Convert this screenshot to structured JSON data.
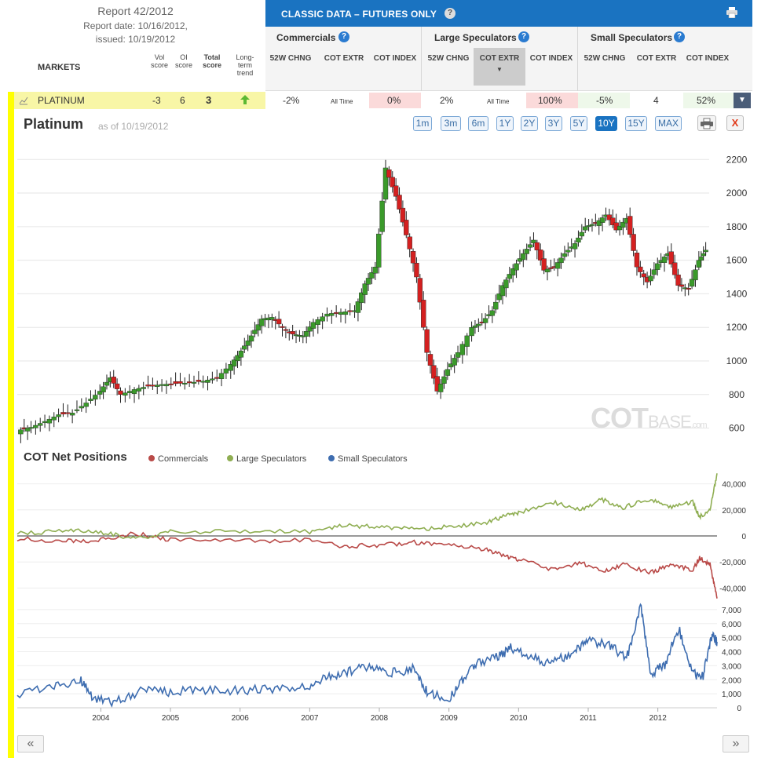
{
  "report": {
    "title": "Report 42/2012",
    "report_date": "Report date: 10/16/2012,",
    "issued": "issued: 10/19/2012"
  },
  "markets_header": {
    "markets": "MARKETS",
    "vol_score": "Vol score",
    "oi_score": "OI score",
    "total_score": "Total score",
    "long_term_trend": "Long-term trend"
  },
  "classic": {
    "title": "CLASSIC DATA – FUTURES ONLY",
    "help": "?"
  },
  "groups": [
    {
      "name": "Commercials",
      "cols": [
        "52W CHNG",
        "COT EXTR",
        "COT INDEX"
      ]
    },
    {
      "name": "Large Speculators",
      "cols": [
        "52W CHNG",
        "COT EXTR",
        "COT INDEX"
      ]
    },
    {
      "name": "Small Speculators",
      "cols": [
        "52W CHNG",
        "COT EXTR",
        "COT INDEX"
      ]
    }
  ],
  "platinum_row": {
    "name": "PLATINUM",
    "vol": "-3",
    "oi": "6",
    "total": "3",
    "comm_chng": "-2%",
    "comm_extr": "All Time",
    "comm_index": "0%",
    "large_chng": "2%",
    "large_extr": "All Time",
    "large_index": "100%",
    "small_chng": "-5%",
    "small_extr": "4",
    "small_index": "52%"
  },
  "chart_header": {
    "title": "Platinum",
    "as_of": "as of 10/19/2012",
    "ranges": [
      "1m",
      "3m",
      "6m",
      "1Y",
      "2Y",
      "3Y",
      "5Y",
      "10Y",
      "15Y",
      "MAX"
    ],
    "active_range": "10Y",
    "close_label": "X"
  },
  "cot_header": {
    "title": "COT Net Positions",
    "legend": [
      {
        "name": "Commercials",
        "color": "#b94a48"
      },
      {
        "name": "Large Speculators",
        "color": "#8fae52"
      },
      {
        "name": "Small Speculators",
        "color": "#3e6db0"
      }
    ]
  },
  "watermark": {
    "main": "COT",
    "sub": "BASE",
    "suffix": ".com"
  },
  "nav": {
    "prev": "«",
    "next": "»"
  },
  "colors": {
    "header_blue": "#1a73c1",
    "candle_up": "#3a9a2a",
    "candle_down": "#d42020",
    "highlight_yellow": "#ffff00",
    "row_yellow": "#f8f6a6",
    "trend_up": "#5cb832"
  },
  "chart_data": [
    {
      "type": "candlestick",
      "title": "Platinum",
      "x_axis": "date",
      "y_ticks": [
        600,
        800,
        1000,
        1200,
        1400,
        1600,
        1800,
        2000,
        2200
      ],
      "x_ticks": [
        "2004",
        "2005",
        "2006",
        "2007",
        "2008",
        "2009",
        "2010",
        "2011",
        "2012"
      ],
      "x_range": [
        2002.8,
        2012.85
      ],
      "y_range": [
        570,
        2290
      ],
      "closes": [
        [
          2002.85,
          590
        ],
        [
          2003.0,
          605
        ],
        [
          2003.2,
          640
        ],
        [
          2003.4,
          680
        ],
        [
          2003.6,
          690
        ],
        [
          2003.8,
          750
        ],
        [
          2004.0,
          820
        ],
        [
          2004.15,
          900
        ],
        [
          2004.3,
          800
        ],
        [
          2004.5,
          830
        ],
        [
          2004.7,
          850
        ],
        [
          2004.9,
          860
        ],
        [
          2005.1,
          865
        ],
        [
          2005.3,
          870
        ],
        [
          2005.5,
          880
        ],
        [
          2005.7,
          900
        ],
        [
          2005.9,
          980
        ],
        [
          2006.05,
          1060
        ],
        [
          2006.2,
          1150
        ],
        [
          2006.35,
          1250
        ],
        [
          2006.5,
          1260
        ],
        [
          2006.65,
          1200
        ],
        [
          2006.8,
          1160
        ],
        [
          2006.95,
          1150
        ],
        [
          2007.1,
          1230
        ],
        [
          2007.3,
          1280
        ],
        [
          2007.5,
          1290
        ],
        [
          2007.7,
          1300
        ],
        [
          2007.85,
          1460
        ],
        [
          2008.0,
          1560
        ],
        [
          2008.15,
          2150
        ],
        [
          2008.3,
          1980
        ],
        [
          2008.45,
          1750
        ],
        [
          2008.6,
          1500
        ],
        [
          2008.75,
          1050
        ],
        [
          2008.9,
          820
        ],
        [
          2009.05,
          950
        ],
        [
          2009.2,
          1050
        ],
        [
          2009.4,
          1200
        ],
        [
          2009.55,
          1230
        ],
        [
          2009.7,
          1300
        ],
        [
          2009.85,
          1450
        ],
        [
          2010.0,
          1550
        ],
        [
          2010.15,
          1640
        ],
        [
          2010.3,
          1720
        ],
        [
          2010.45,
          1540
        ],
        [
          2010.6,
          1560
        ],
        [
          2010.75,
          1640
        ],
        [
          2010.9,
          1700
        ],
        [
          2011.05,
          1800
        ],
        [
          2011.2,
          1820
        ],
        [
          2011.35,
          1870
        ],
        [
          2011.5,
          1780
        ],
        [
          2011.65,
          1850
        ],
        [
          2011.8,
          1560
        ],
        [
          2011.95,
          1470
        ],
        [
          2012.1,
          1580
        ],
        [
          2012.25,
          1640
        ],
        [
          2012.4,
          1450
        ],
        [
          2012.55,
          1430
        ],
        [
          2012.7,
          1600
        ],
        [
          2012.8,
          1660
        ]
      ]
    },
    {
      "type": "line",
      "title": "COT Net Positions",
      "series": [
        {
          "name": "Commercials",
          "values": [
            [
              2002.8,
              -2000
            ],
            [
              2003.5,
              -4000
            ],
            [
              2004.0,
              -3000
            ],
            [
              2004.5,
              2000
            ],
            [
              2005.0,
              -3000
            ],
            [
              2006.0,
              -4000
            ],
            [
              2007.0,
              -3000
            ],
            [
              2007.5,
              -8000
            ],
            [
              2008.0,
              -7000
            ],
            [
              2008.5,
              -5000
            ],
            [
              2009.0,
              -7000
            ],
            [
              2009.5,
              -10000
            ],
            [
              2009.8,
              -15000
            ],
            [
              2010.0,
              -18000
            ],
            [
              2010.5,
              -26000
            ],
            [
              2010.9,
              -20000
            ],
            [
              2011.2,
              -28000
            ],
            [
              2011.5,
              -22000
            ],
            [
              2011.9,
              -28000
            ],
            [
              2012.2,
              -22000
            ],
            [
              2012.5,
              -26000
            ],
            [
              2012.6,
              -17000
            ],
            [
              2012.75,
              -22000
            ],
            [
              2012.85,
              -48000
            ]
          ]
        },
        {
          "name": "Large Speculators",
          "values": [
            [
              2002.8,
              2000
            ],
            [
              2003.5,
              4000
            ],
            [
              2004.0,
              3000
            ],
            [
              2004.5,
              -2000
            ],
            [
              2005.0,
              3000
            ],
            [
              2006.0,
              4000
            ],
            [
              2007.0,
              3000
            ],
            [
              2007.5,
              8000
            ],
            [
              2008.0,
              7000
            ],
            [
              2008.5,
              5000
            ],
            [
              2009.0,
              7000
            ],
            [
              2009.5,
              10000
            ],
            [
              2009.8,
              15000
            ],
            [
              2010.0,
              18000
            ],
            [
              2010.5,
              26000
            ],
            [
              2010.9,
              20000
            ],
            [
              2011.2,
              28000
            ],
            [
              2011.5,
              22000
            ],
            [
              2011.9,
              28000
            ],
            [
              2012.2,
              22000
            ],
            [
              2012.5,
              26000
            ],
            [
              2012.6,
              15000
            ],
            [
              2012.75,
              20000
            ],
            [
              2012.85,
              48000
            ]
          ]
        },
        {
          "name": "Small Speculators",
          "values": [
            [
              2002.8,
              1000
            ],
            [
              2003.3,
              1500
            ],
            [
              2003.7,
              2000
            ],
            [
              2003.9,
              600
            ],
            [
              2004.2,
              400
            ],
            [
              2004.6,
              1200
            ],
            [
              2005.0,
              1100
            ],
            [
              2005.5,
              1300
            ],
            [
              2006.0,
              1200
            ],
            [
              2006.5,
              1400
            ],
            [
              2007.0,
              1600
            ],
            [
              2007.3,
              2200
            ],
            [
              2007.6,
              2600
            ],
            [
              2007.9,
              3000
            ],
            [
              2008.2,
              2500
            ],
            [
              2008.5,
              2800
            ],
            [
              2008.7,
              1000
            ],
            [
              2009.0,
              700
            ],
            [
              2009.2,
              2000
            ],
            [
              2009.4,
              3200
            ],
            [
              2009.7,
              3600
            ],
            [
              2009.9,
              4300
            ],
            [
              2010.2,
              3500
            ],
            [
              2010.5,
              3200
            ],
            [
              2010.8,
              4000
            ],
            [
              2011.0,
              4700
            ],
            [
              2011.3,
              4500
            ],
            [
              2011.55,
              3500
            ],
            [
              2011.75,
              7300
            ],
            [
              2011.9,
              2500
            ],
            [
              2012.1,
              3000
            ],
            [
              2012.3,
              5700
            ],
            [
              2012.5,
              2400
            ],
            [
              2012.65,
              2300
            ],
            [
              2012.78,
              5300
            ],
            [
              2012.85,
              4700
            ]
          ]
        }
      ],
      "y_ticks_net": [
        -40000,
        -20000,
        0,
        20000,
        40000
      ],
      "y_ticks_small": [
        0,
        1000,
        2000,
        3000,
        4000,
        5000,
        6000,
        7000
      ]
    }
  ]
}
